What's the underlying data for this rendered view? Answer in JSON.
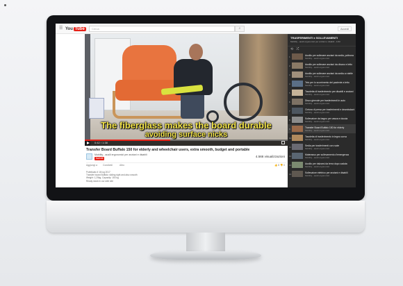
{
  "browser": {
    "logo_you": "You",
    "logo_tube": "Tube",
    "search_placeholder": "Cerca",
    "signin_label": "Accedi"
  },
  "player": {
    "subtitle_line1": "The fiberglass makes the board durable",
    "subtitle_line2": "avoiding surface nicks",
    "progress_fraction": 0.42,
    "time": "0:42 / 1:38"
  },
  "video": {
    "title": "Transfer Board Buffalo 150 for elderly and wheelchair users, extra smooth, budget and portable",
    "channel": "Mobility - ausili ergonomici per anziani e disabili",
    "subscribe_label": "Iscriviti",
    "views": "4.566 visualizzazioni",
    "actions": [
      "Aggiungi a",
      "Condividi",
      "Altro"
    ],
    "likes": "👍 8   👎 0",
    "description": [
      "Pubblicato il 16 lug 2017",
      "Transfer board Buffalo: sliding right and also smooth",
      "Weight: 1,25kg; Capacity: 150 kg",
      "Ready stock in our web site"
    ]
  },
  "sidebar": {
    "title": "TRASFERIMENTI e SOLLEVAMENTI",
    "subtitle": "Mobility - ausili ergonomici per anziani e disabili - 1/33",
    "items": [
      {
        "index": "1",
        "title": "Ausilio per sollevare anziani da sedia, poltrona",
        "channel": "Mobility - ausili ergonomici",
        "thumb": "#6d5a4a"
      },
      {
        "index": "2",
        "title": "Ausilio per sollevare anziani da divano e letto",
        "channel": "Mobility - ausili ergonomici",
        "thumb": "#8a7a66"
      },
      {
        "index": "3",
        "title": "Ausilio per sollevare anziani da sedia a rotelle",
        "channel": "Mobility - ausili ergonomici",
        "thumb": "#a0907c"
      },
      {
        "index": "4",
        "title": "Telo per lo scorrimento del paziente a letto",
        "channel": "Mobility - ausili ergonomici",
        "thumb": "#5b6f86"
      },
      {
        "index": "5",
        "title": "Tavoletta di trasferimento per disabili e anziani",
        "channel": "Mobility - ausili ergonomici",
        "thumb": "#c5b399"
      },
      {
        "index": "6",
        "title": "Disco girevole per trasferimenti in auto",
        "channel": "Mobility - ausili ergonomici",
        "thumb": "#7d7164"
      },
      {
        "index": "7",
        "title": "Cintura di presa per trasferimenti e deambulazione",
        "channel": "Mobility - ausili ergonomici",
        "thumb": "#4d5660"
      },
      {
        "index": "8",
        "title": "Sollevatore da bagno per vasca e doccia",
        "channel": "Mobility - ausili ergonomici",
        "thumb": "#8c8c8c"
      },
      {
        "index": "9",
        "title": "Transfer Board Buffalo 150 for elderly",
        "channel": "Mobility - ausili ergonomici",
        "thumb": "#9a6a4a"
      },
      {
        "index": "10",
        "title": "Tavoletta di trasferimento in legno curva",
        "channel": "Mobility - ausili ergonomici",
        "thumb": "#b08a5e"
      },
      {
        "index": "11",
        "title": "Sedia per trasferimenti con ruote",
        "channel": "Mobility - ausili ergonomici",
        "thumb": "#6a6a72"
      },
      {
        "index": "12",
        "title": "Materasso per sollevamento d'emergenza",
        "channel": "Mobility - ausili ergonomici",
        "thumb": "#5a6672"
      },
      {
        "index": "13",
        "title": "Ausilio per rialzarsi da terra dopo caduta",
        "channel": "Mobility - ausili ergonomici",
        "thumb": "#7b8a70"
      },
      {
        "index": "14",
        "title": "Sollevatore elettrico per anziani e disabili",
        "channel": "Mobility - ausili ergonomici",
        "thumb": "#5f5850"
      }
    ]
  },
  "colors": {
    "youtube_red": "#e62117",
    "subtitle_yellow": "#f2e34a",
    "sidebar_bg": "#2b2b2b"
  }
}
